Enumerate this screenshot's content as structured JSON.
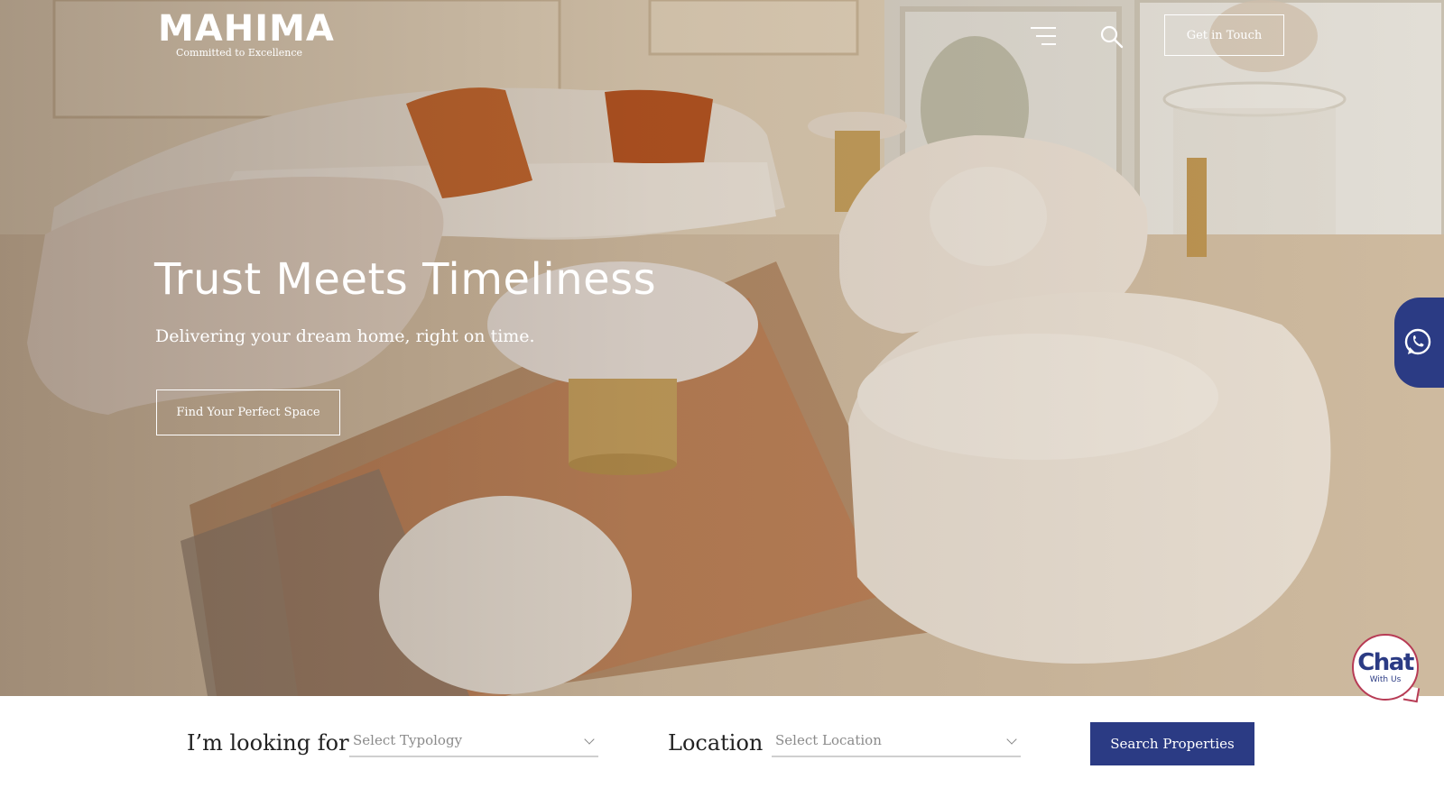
{
  "header": {
    "logo_text": "MAHIMA",
    "tagline": "Committed to Excellence",
    "cta_label": "Get in Touch"
  },
  "hero": {
    "title": "Trust Meets Timeliness",
    "subtitle": "Delivering your dream home, right on time.",
    "button_label": "Find Your Perfect Space"
  },
  "search": {
    "looking_for_label": "I’m looking for",
    "typology_placeholder": "Select Typology",
    "location_label": "Location",
    "location_placeholder": "Select Location",
    "button_label": "Search Properties"
  },
  "chat": {
    "title": "Chat",
    "subtitle": "With Us"
  },
  "colors": {
    "brand_blue": "#2b3b84",
    "chat_border": "#b73b55"
  },
  "icons": {
    "menu": "menu-icon",
    "search": "search-icon",
    "whatsapp": "whatsapp-icon"
  }
}
